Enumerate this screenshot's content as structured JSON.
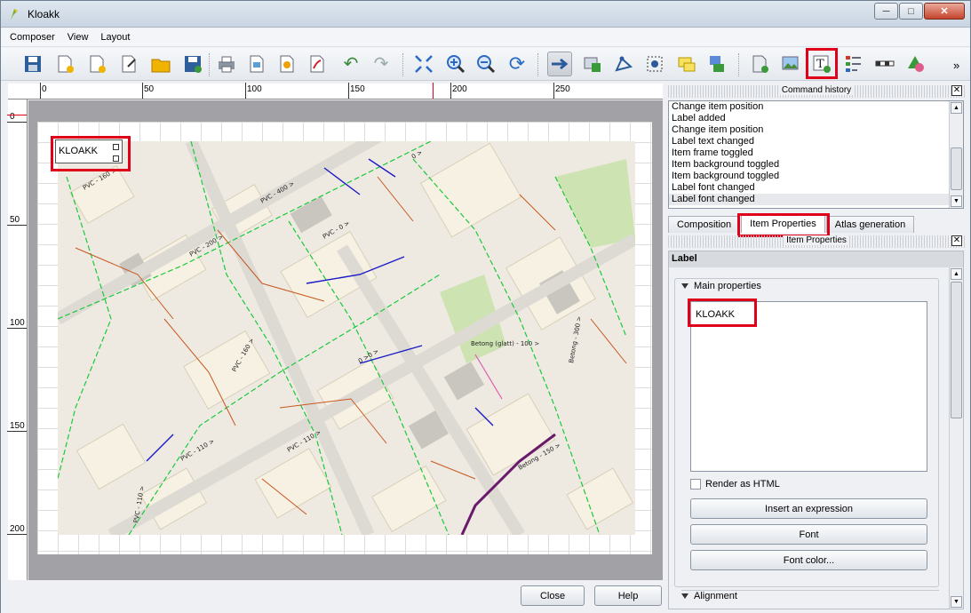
{
  "window": {
    "title": "Kloakk"
  },
  "menu": [
    "Composer",
    "View",
    "Layout"
  ],
  "toolbar": {
    "icons": [
      "save-icon",
      "new-composer-icon",
      "duplicate-composer-icon",
      "composer-manager-icon",
      "open-template-icon",
      "save-template-icon",
      "print-icon",
      "export-image-icon",
      "export-svg-icon",
      "export-pdf-icon",
      "undo-icon",
      "redo-icon",
      "zoom-full-icon",
      "zoom-in-icon",
      "zoom-out-icon",
      "refresh-icon",
      "select-move-icon",
      "move-content-icon",
      "edit-nodes-icon",
      "select-icon",
      "group-icon",
      "raise-icon",
      "add-map-icon",
      "add-image-icon",
      "add-label-icon",
      "add-legend-icon",
      "add-scalebar-icon",
      "add-shape-icon"
    ],
    "overflow": "»"
  },
  "ruler": {
    "h_labels": [
      "0",
      "50",
      "100",
      "150",
      "200",
      "250"
    ],
    "v_labels": [
      "0",
      "50",
      "100",
      "150",
      "200"
    ]
  },
  "map_label": {
    "text": "KLOAKK"
  },
  "buttons": {
    "close": "Close",
    "help": "Help"
  },
  "command_history": {
    "title": "Command history",
    "items": [
      "Change item position",
      "Label added",
      "Change item position",
      "Label text changed",
      "Item frame toggled",
      "Item background toggled",
      "Item background toggled",
      "Label font changed",
      "Label font changed"
    ],
    "selected_index": 8
  },
  "tabs": [
    "Composition",
    "Item Properties",
    "Atlas generation"
  ],
  "active_tab": "Item Properties",
  "item_properties": {
    "title": "Item Properties",
    "section": "Label",
    "main_group": "Main properties",
    "label_text": "KLOAKK",
    "render_html": "Render as HTML",
    "insert_expression": "Insert an expression",
    "font": "Font",
    "font_color": "Font color...",
    "alignment": "Alignment"
  },
  "colors": {
    "highlight": "#e0001a",
    "pipe_green": "#19c93a",
    "pipe_orange": "#c8561c",
    "pipe_blue": "#1a1ac8",
    "map_bg": "#eeeae2"
  }
}
